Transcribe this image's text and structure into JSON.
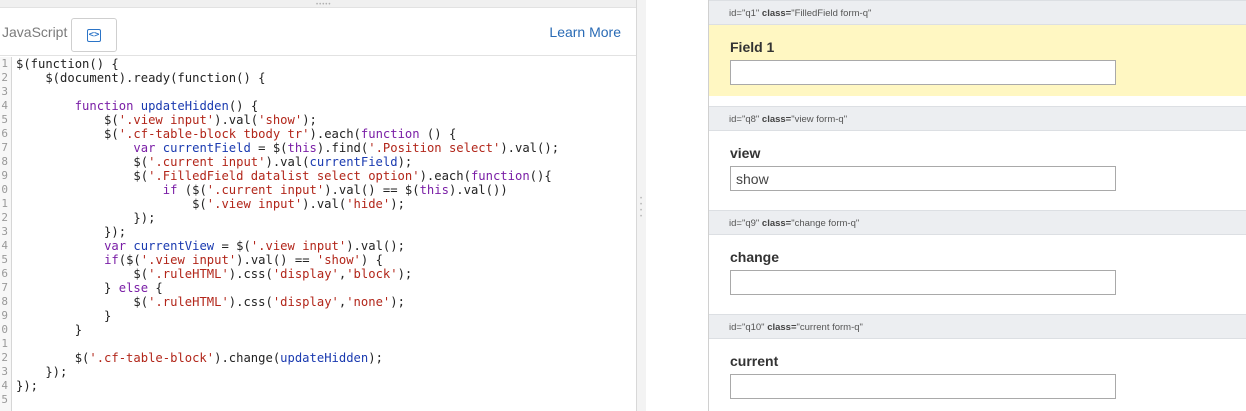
{
  "editor": {
    "language": "JavaScript",
    "toggle_icon": "code-icon",
    "learn_more": "Learn More",
    "line_numbers": [
      "1",
      "2",
      "3",
      "4",
      "5",
      "6",
      "7",
      "8",
      "9",
      "0",
      "1",
      "2",
      "3",
      "4",
      "5",
      "6",
      "7",
      "8",
      "9",
      "0",
      "1",
      "2",
      "3",
      "4",
      "5"
    ],
    "code_lines": [
      [
        {
          "t": "plain",
          "v": "$(function() {"
        }
      ],
      [
        {
          "t": "plain",
          "v": "    $(document).ready(function() {"
        }
      ],
      [
        {
          "t": "plain",
          "v": ""
        }
      ],
      [
        {
          "t": "plain",
          "v": "        "
        },
        {
          "t": "kw",
          "v": "function"
        },
        {
          "t": "plain",
          "v": " "
        },
        {
          "t": "var",
          "v": "updateHidden"
        },
        {
          "t": "plain",
          "v": "() {"
        }
      ],
      [
        {
          "t": "plain",
          "v": "            $("
        },
        {
          "t": "str",
          "v": "'.view input'"
        },
        {
          "t": "plain",
          "v": ").val("
        },
        {
          "t": "str",
          "v": "'show'"
        },
        {
          "t": "plain",
          "v": ");"
        }
      ],
      [
        {
          "t": "plain",
          "v": "            $("
        },
        {
          "t": "str",
          "v": "'.cf-table-block tbody tr'"
        },
        {
          "t": "plain",
          "v": ").each("
        },
        {
          "t": "kw",
          "v": "function"
        },
        {
          "t": "plain",
          "v": " () {"
        }
      ],
      [
        {
          "t": "plain",
          "v": "                "
        },
        {
          "t": "kw",
          "v": "var"
        },
        {
          "t": "plain",
          "v": " "
        },
        {
          "t": "var",
          "v": "currentField"
        },
        {
          "t": "plain",
          "v": " = $("
        },
        {
          "t": "kw",
          "v": "this"
        },
        {
          "t": "plain",
          "v": ").find("
        },
        {
          "t": "str",
          "v": "'.Position select'"
        },
        {
          "t": "plain",
          "v": ").val();"
        }
      ],
      [
        {
          "t": "plain",
          "v": "                $("
        },
        {
          "t": "str",
          "v": "'.current input'"
        },
        {
          "t": "plain",
          "v": ").val("
        },
        {
          "t": "var",
          "v": "currentField"
        },
        {
          "t": "plain",
          "v": ");"
        }
      ],
      [
        {
          "t": "plain",
          "v": "                $("
        },
        {
          "t": "str",
          "v": "'.FilledField datalist select option'"
        },
        {
          "t": "plain",
          "v": ").each("
        },
        {
          "t": "kw",
          "v": "function"
        },
        {
          "t": "plain",
          "v": "(){"
        }
      ],
      [
        {
          "t": "plain",
          "v": "                    "
        },
        {
          "t": "kw",
          "v": "if"
        },
        {
          "t": "plain",
          "v": " ($("
        },
        {
          "t": "str",
          "v": "'.current input'"
        },
        {
          "t": "plain",
          "v": ").val() == $("
        },
        {
          "t": "kw",
          "v": "this"
        },
        {
          "t": "plain",
          "v": ").val())"
        }
      ],
      [
        {
          "t": "plain",
          "v": "                        $("
        },
        {
          "t": "str",
          "v": "'.view input'"
        },
        {
          "t": "plain",
          "v": ").val("
        },
        {
          "t": "str",
          "v": "'hide'"
        },
        {
          "t": "plain",
          "v": ");"
        }
      ],
      [
        {
          "t": "plain",
          "v": "                });"
        }
      ],
      [
        {
          "t": "plain",
          "v": "            });"
        }
      ],
      [
        {
          "t": "plain",
          "v": "            "
        },
        {
          "t": "kw",
          "v": "var"
        },
        {
          "t": "plain",
          "v": " "
        },
        {
          "t": "var",
          "v": "currentView"
        },
        {
          "t": "plain",
          "v": " = $("
        },
        {
          "t": "str",
          "v": "'.view input'"
        },
        {
          "t": "plain",
          "v": ").val();"
        }
      ],
      [
        {
          "t": "plain",
          "v": "            "
        },
        {
          "t": "kw",
          "v": "if"
        },
        {
          "t": "plain",
          "v": "($("
        },
        {
          "t": "str",
          "v": "'.view input'"
        },
        {
          "t": "plain",
          "v": ").val() == "
        },
        {
          "t": "str",
          "v": "'show'"
        },
        {
          "t": "plain",
          "v": ") {"
        }
      ],
      [
        {
          "t": "plain",
          "v": "                $("
        },
        {
          "t": "str",
          "v": "'.ruleHTML'"
        },
        {
          "t": "plain",
          "v": ").css("
        },
        {
          "t": "str",
          "v": "'display'"
        },
        {
          "t": "plain",
          "v": ","
        },
        {
          "t": "str",
          "v": "'block'"
        },
        {
          "t": "plain",
          "v": ");"
        }
      ],
      [
        {
          "t": "plain",
          "v": "            } "
        },
        {
          "t": "kw",
          "v": "else"
        },
        {
          "t": "plain",
          "v": " {"
        }
      ],
      [
        {
          "t": "plain",
          "v": "                $("
        },
        {
          "t": "str",
          "v": "'.ruleHTML'"
        },
        {
          "t": "plain",
          "v": ").css("
        },
        {
          "t": "str",
          "v": "'display'"
        },
        {
          "t": "plain",
          "v": ","
        },
        {
          "t": "str",
          "v": "'none'"
        },
        {
          "t": "plain",
          "v": ");"
        }
      ],
      [
        {
          "t": "plain",
          "v": "            }"
        }
      ],
      [
        {
          "t": "plain",
          "v": "        }"
        }
      ],
      [
        {
          "t": "plain",
          "v": ""
        }
      ],
      [
        {
          "t": "plain",
          "v": "        $("
        },
        {
          "t": "str",
          "v": "'.cf-table-block'"
        },
        {
          "t": "plain",
          "v": ").change("
        },
        {
          "t": "var",
          "v": "updateHidden"
        },
        {
          "t": "plain",
          "v": ");"
        }
      ],
      [
        {
          "t": "plain",
          "v": "    });"
        }
      ],
      [
        {
          "t": "plain",
          "v": "});"
        }
      ],
      [
        {
          "t": "plain",
          "v": ""
        }
      ]
    ]
  },
  "form": {
    "questions": [
      {
        "meta_id": "id=\"q1\"",
        "meta_class_key": "class=",
        "meta_class_val": "\"FilledField form-q\"",
        "label": "Field 1",
        "value": "",
        "highlight": true
      },
      {
        "meta_id": "id=\"q8\"",
        "meta_class_key": "class=",
        "meta_class_val": "\"view form-q\"",
        "label": "view",
        "value": "show",
        "highlight": false
      },
      {
        "meta_id": "id=\"q9\"",
        "meta_class_key": "class=",
        "meta_class_val": "\"change form-q\"",
        "label": "change",
        "value": "",
        "highlight": false
      },
      {
        "meta_id": "id=\"q10\"",
        "meta_class_key": "class=",
        "meta_class_val": "\"current form-q\"",
        "label": "current",
        "value": "",
        "highlight": false
      }
    ]
  },
  "colors": {
    "keyword": "#7a1ea6",
    "string": "#b2261a",
    "variable": "#1a3ab0",
    "link": "#2a6bb5",
    "highlight": "#fff7c2"
  }
}
